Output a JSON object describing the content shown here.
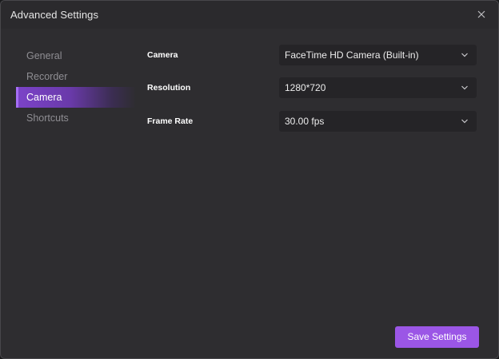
{
  "window": {
    "title": "Advanced Settings"
  },
  "icons": {
    "close": "close-icon",
    "dropdown": "chevron-down-icon"
  },
  "sidebar": {
    "items": [
      {
        "label": "General",
        "active": false
      },
      {
        "label": "Recorder",
        "active": false
      },
      {
        "label": "Camera",
        "active": true
      },
      {
        "label": "Shortcuts",
        "active": false
      }
    ]
  },
  "camera_settings": {
    "camera": {
      "label": "Camera",
      "value": "FaceTime HD Camera (Built-in)"
    },
    "resolution": {
      "label": "Resolution",
      "value": "1280*720"
    },
    "frame_rate": {
      "label": "Frame Rate",
      "value": "30.00 fps"
    }
  },
  "footer": {
    "save_label": "Save Settings"
  },
  "colors": {
    "accent": "#9b56e6",
    "active_nav": "#7c43c9",
    "background": "#2e2d30",
    "select_bg": "#252427"
  }
}
